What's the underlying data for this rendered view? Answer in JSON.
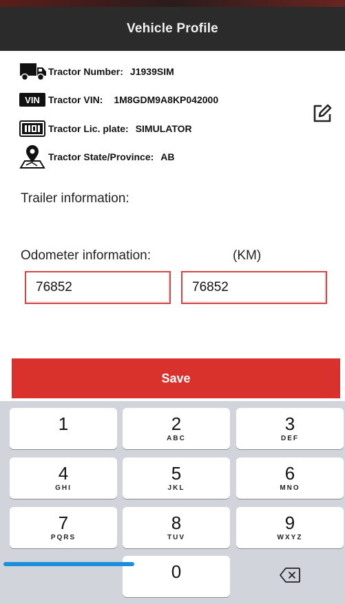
{
  "header": {
    "title": "Vehicle Profile"
  },
  "vehicle": {
    "tractor_number_label": "Tractor Number:",
    "tractor_number_value": "J1939SIM",
    "vin_badge": "VIN",
    "tractor_vin_label": "Tractor VIN:",
    "tractor_vin_value": "1M8GDM9A8KP042000",
    "plate_badge": "IIDI",
    "tractor_plate_label": "Tractor Lic. plate:",
    "tractor_plate_value": "SIMULATOR",
    "tractor_state_label": "Tractor State/Province:",
    "tractor_state_value": "AB"
  },
  "trailer": {
    "label": "Trailer information:"
  },
  "odometer": {
    "label": "Odometer information:",
    "unit": "(KM)",
    "value_1": "76852",
    "value_2": "76852"
  },
  "save_label": "Save",
  "keypad": {
    "keys": [
      {
        "num": "1",
        "letters": ""
      },
      {
        "num": "2",
        "letters": "ABC"
      },
      {
        "num": "3",
        "letters": "DEF"
      },
      {
        "num": "4",
        "letters": "GHI"
      },
      {
        "num": "5",
        "letters": "JKL"
      },
      {
        "num": "6",
        "letters": "MNO"
      },
      {
        "num": "7",
        "letters": "PQRS"
      },
      {
        "num": "8",
        "letters": "TUV"
      },
      {
        "num": "9",
        "letters": "WXYZ"
      },
      {
        "num": "0",
        "letters": ""
      }
    ]
  },
  "icons": {
    "truck": "truck-icon",
    "vin": "vin-badge-icon",
    "plate": "license-plate-icon",
    "location": "map-pin-icon",
    "edit": "edit-icon",
    "delete": "backspace-icon"
  },
  "colors": {
    "header_bg": "#2b2b2b",
    "accent_red": "#d9312b",
    "input_border": "#d94343",
    "keyboard_bg": "#d1d4da"
  }
}
